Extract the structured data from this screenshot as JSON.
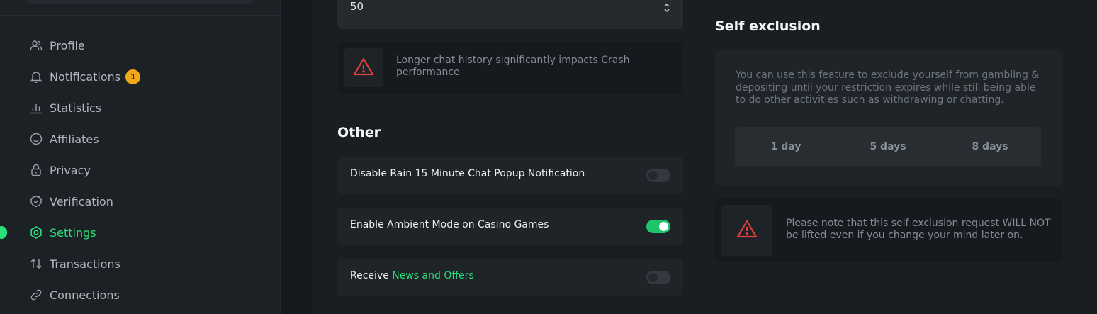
{
  "sidebar": {
    "items": [
      {
        "label": "Profile",
        "icon": "profile-icon"
      },
      {
        "label": "Notifications",
        "icon": "bell-icon",
        "badge": "1"
      },
      {
        "label": "Statistics",
        "icon": "bar-chart-icon"
      },
      {
        "label": "Affiliates",
        "icon": "smiley-icon"
      },
      {
        "label": "Privacy",
        "icon": "lock-icon"
      },
      {
        "label": "Verification",
        "icon": "badge-check-icon"
      },
      {
        "label": "Settings",
        "icon": "gear-icon",
        "active": true
      },
      {
        "label": "Transactions",
        "icon": "transfer-arrows-icon"
      },
      {
        "label": "Connections",
        "icon": "link-icon"
      }
    ]
  },
  "chat": {
    "history_value": "50",
    "warning": "Longer chat history significantly impacts Crash performance"
  },
  "other": {
    "title": "Other",
    "toggles": [
      {
        "label": "Disable Rain 15 Minute Chat Popup Notification",
        "on": false
      },
      {
        "label": "Enable Ambient Mode on Casino Games",
        "on": true
      },
      {
        "label_prefix": "Receive ",
        "label_accent": "News and Offers",
        "on": false
      }
    ]
  },
  "self_exclusion": {
    "title": "Self exclusion",
    "description": "You can use this feature to exclude yourself from gambling & depositing until your restriction expires while still being able to do other activities such as withdrawing or chatting.",
    "options": [
      "1 day",
      "5 days",
      "8 days"
    ],
    "warning": "Please note that this self exclusion request WILL NOT be lifted even if you change your mind later on."
  },
  "colors": {
    "accent": "#27e07a",
    "badge": "#f2a71b",
    "warning": "#e0403c"
  }
}
